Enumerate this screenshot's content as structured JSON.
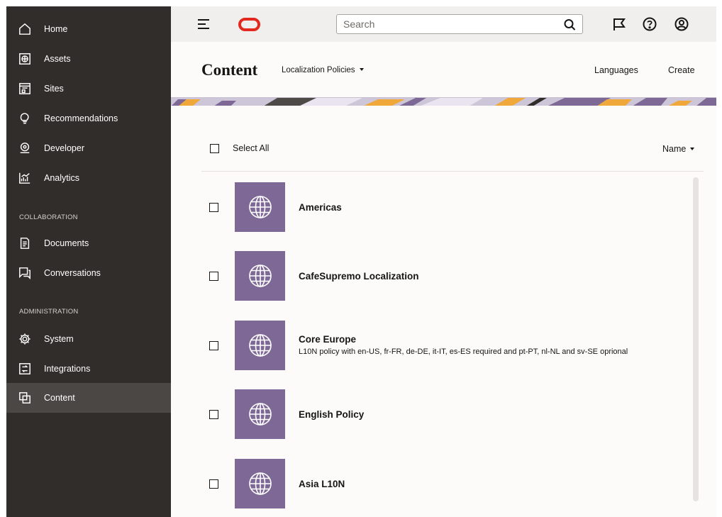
{
  "sidebar": {
    "items": [
      {
        "label": "Home",
        "icon": "home-icon"
      },
      {
        "label": "Assets",
        "icon": "assets-icon"
      },
      {
        "label": "Sites",
        "icon": "sites-icon"
      },
      {
        "label": "Recommendations",
        "icon": "lightbulb-icon"
      },
      {
        "label": "Developer",
        "icon": "developer-icon"
      },
      {
        "label": "Analytics",
        "icon": "analytics-icon"
      },
      {
        "label": "Documents",
        "icon": "documents-icon"
      },
      {
        "label": "Conversations",
        "icon": "conversations-icon"
      },
      {
        "label": "System",
        "icon": "gear-icon"
      },
      {
        "label": "Integrations",
        "icon": "integrations-icon"
      },
      {
        "label": "Content",
        "icon": "content-icon"
      }
    ],
    "sections": {
      "collaboration": "COLLABORATION",
      "administration": "ADMINISTRATION"
    },
    "active_item": "Content",
    "background_color": "#312d2a",
    "active_color": "#4a4744"
  },
  "topbar": {
    "search": {
      "placeholder": "Search",
      "value": ""
    },
    "icons": [
      "menu-icon",
      "oracle-logo",
      "search-icon",
      "flag-icon",
      "help-icon",
      "user-icon"
    ],
    "logo_color": "#e3281d"
  },
  "header": {
    "title": "Content",
    "policy_dropdown": "Localization Policies",
    "languages_label": "Languages",
    "create_label": "Create"
  },
  "list": {
    "select_all_label": "Select All",
    "sort_label": "Name",
    "thumbnail_color": "#7e6996",
    "thumbnail_icon": "globe-icon",
    "policies": [
      {
        "title": "Americas",
        "description": ""
      },
      {
        "title": "CafeSupremo Localization",
        "description": ""
      },
      {
        "title": "Core Europe",
        "description": "L10N policy with en-US, fr-FR, de-DE, it-IT, es-ES required and pt-PT, nl-NL and sv-SE oprional"
      },
      {
        "title": "English Policy",
        "description": ""
      },
      {
        "title": "Asia L10N",
        "description": ""
      }
    ]
  }
}
